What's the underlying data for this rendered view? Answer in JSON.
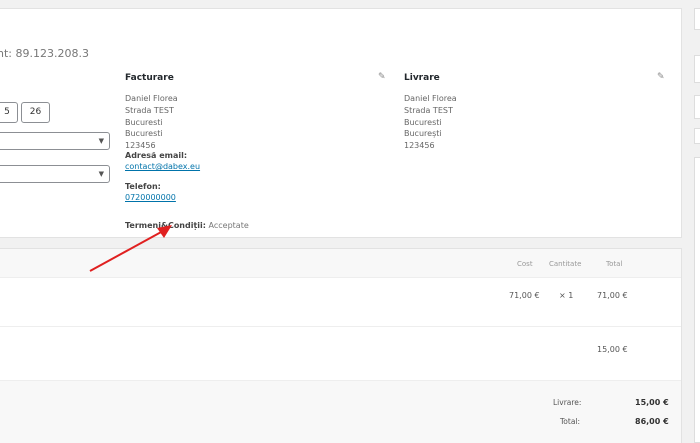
{
  "order": {
    "ip_text": "nt: 89.123.208.3",
    "date_parts": [
      "5",
      "26"
    ]
  },
  "billing": {
    "title": "Facturare",
    "address_lines": [
      "Daniel Florea",
      "Strada TEST",
      "Bucuresti",
      "Bucuresti",
      "123456"
    ],
    "email_label": "Adresă email:",
    "email": "contact@dabex.eu",
    "phone_label": "Telefon:",
    "phone": "0720000000",
    "terms_label": "Termeni&Condiții:",
    "terms_value": "Acceptate"
  },
  "shipping": {
    "title": "Livrare",
    "address_lines": [
      "Daniel Florea",
      "Strada TEST",
      "Bucuresti",
      "București",
      "123456"
    ]
  },
  "items": {
    "headers": {
      "cost": "Cost",
      "qty": "Cantitate",
      "total": "Total"
    },
    "rows": [
      {
        "cost": "71,00 €",
        "qty": "× 1",
        "total": "71,00 €"
      }
    ],
    "shipping_line_total": "15,00 €"
  },
  "totals": {
    "shipping_label": "Livrare:",
    "shipping_value": "15,00 €",
    "total_label": "Total:",
    "total_value": "86,00 €"
  },
  "colors": {
    "link": "#0073aa",
    "arrow": "#e02020"
  }
}
